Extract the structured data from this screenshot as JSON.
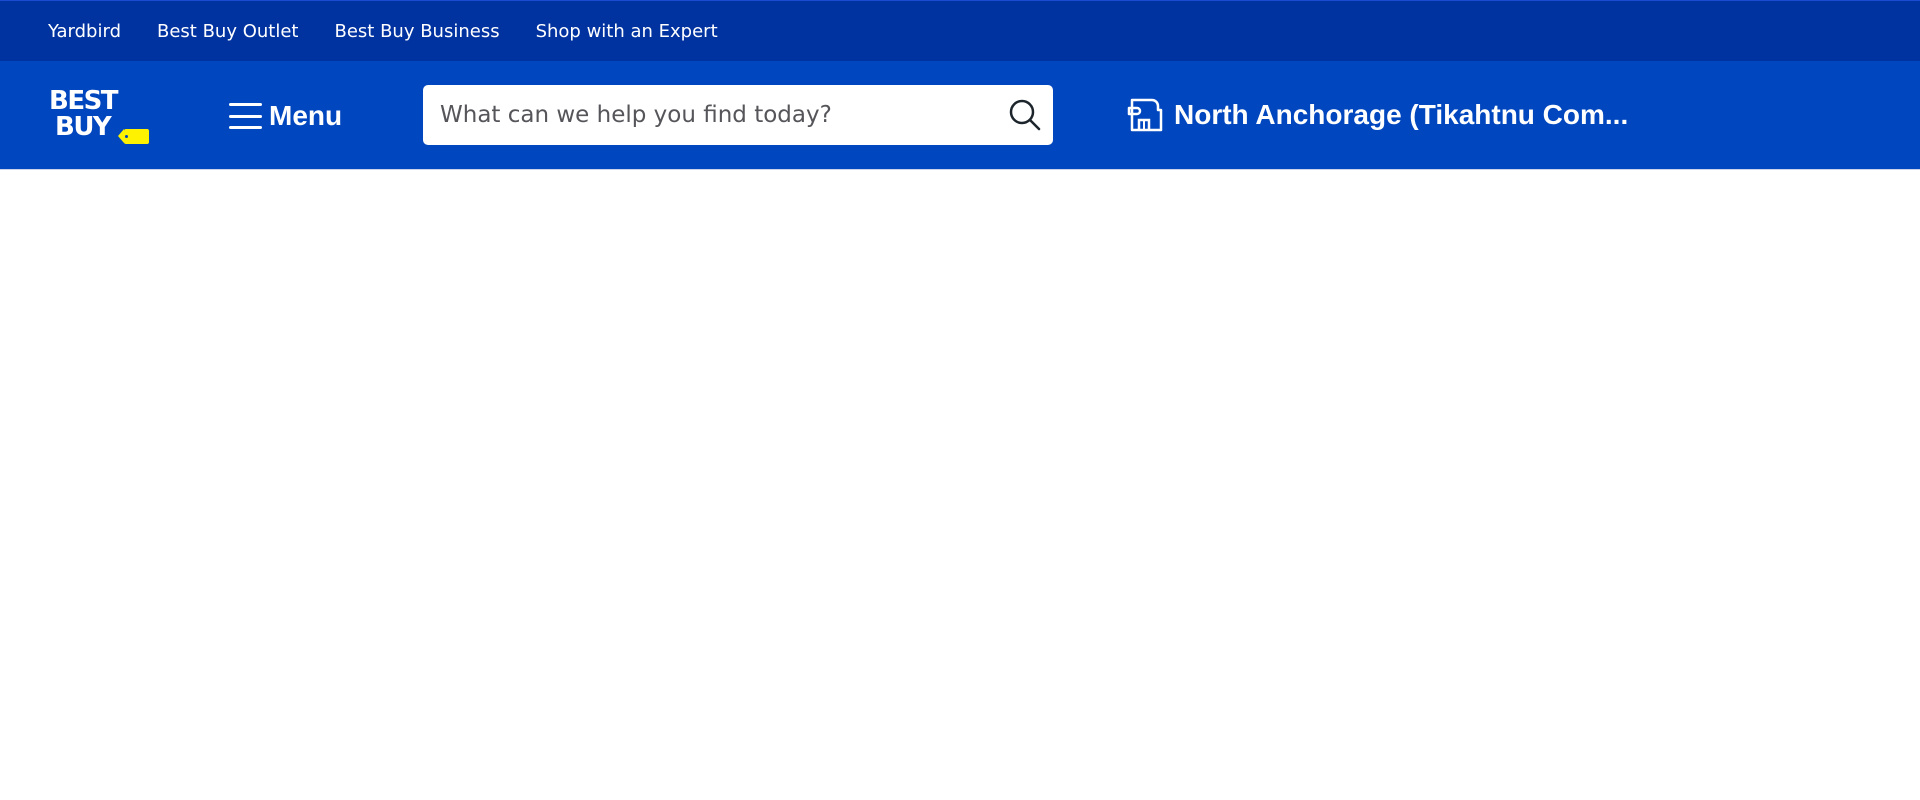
{
  "top_nav": {
    "links": [
      {
        "label": "Yardbird"
      },
      {
        "label": "Best Buy Outlet"
      },
      {
        "label": "Best Buy Business"
      },
      {
        "label": "Shop with an Expert"
      }
    ]
  },
  "header": {
    "logo": {
      "line1": "BEST",
      "line2": "BUY",
      "icon": "price-tag-icon"
    },
    "menu": {
      "label": "Menu",
      "icon": "hamburger-icon"
    },
    "search": {
      "placeholder": "What can we help you find today?",
      "value": "",
      "icon": "search-icon"
    },
    "store": {
      "label": "North Anchorage (Tikahtnu Com...",
      "icon": "store-icon"
    }
  },
  "colors": {
    "top_bar": "#0032a0",
    "header": "#0046be",
    "logo_tag": "#fff200"
  }
}
